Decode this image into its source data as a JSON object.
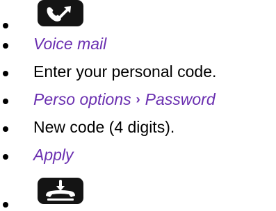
{
  "steps": [
    {
      "kind": "key",
      "icon": "handsfree-key-icon"
    },
    {
      "kind": "menu",
      "text": "Voice mail"
    },
    {
      "kind": "text",
      "text": "Enter your personal code."
    },
    {
      "kind": "menu-path",
      "parts": [
        "Perso options",
        "Password"
      ],
      "separator": "›"
    },
    {
      "kind": "text",
      "text": "New code (4 digits)."
    },
    {
      "kind": "menu",
      "text": "Apply"
    },
    {
      "kind": "key",
      "icon": "hang-up-key-icon"
    }
  ],
  "colors": {
    "menu_text": "#6a2fb0",
    "plain_text": "#000000",
    "key_background": "#141414"
  }
}
